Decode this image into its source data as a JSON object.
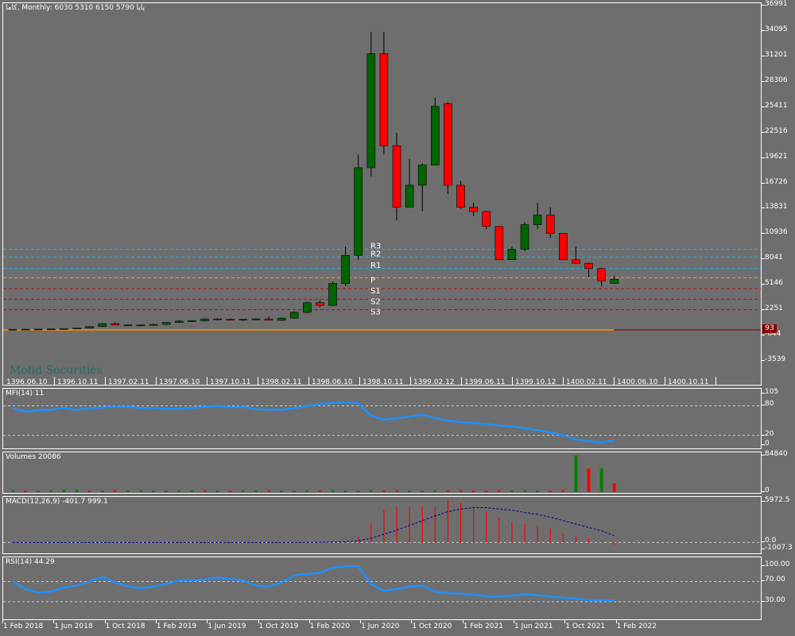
{
  "main_chart": {
    "header": "کاما, Monthly:  6030 5310 6150 5790  پایا",
    "watermark": "Mofid Securities",
    "price_levels": [
      "36991",
      "34095",
      "31201",
      "28306",
      "25411",
      "22516",
      "19621",
      "16726",
      "13831",
      "10936",
      "8041",
      "5146",
      "2251",
      "-644",
      "-3539"
    ],
    "price_values": [
      36991,
      34095,
      31201,
      28306,
      25411,
      22516,
      19621,
      16726,
      13831,
      10936,
      8041,
      5146,
      2251,
      -644,
      -3539
    ],
    "pivot_labels": [
      "R3",
      "R2",
      "R1",
      "P",
      "S1",
      "S2",
      "S3"
    ],
    "last_value_badge": "93",
    "top_date_labels": [
      "1396.06.10",
      "1396.10.11",
      "1397.02.11",
      "1397.06.10",
      "1397.10.11",
      "1398.02.11",
      "1398.06.10",
      "1398.10.11",
      "1399.02.12",
      "1399.06.11",
      "1399.10.12",
      "1400.02.11",
      "1400.06.10",
      "1400.10.11"
    ]
  },
  "chart_data": {
    "type": "candlestick",
    "candles": [
      {
        "o": 60,
        "h": 80,
        "l": 40,
        "c": 70
      },
      {
        "o": 70,
        "h": 90,
        "l": 50,
        "c": 80
      },
      {
        "o": 80,
        "h": 110,
        "l": 60,
        "c": 90
      },
      {
        "o": 90,
        "h": 130,
        "l": 70,
        "c": 110
      },
      {
        "o": 110,
        "h": 160,
        "l": 90,
        "c": 140
      },
      {
        "o": 140,
        "h": 220,
        "l": 120,
        "c": 200
      },
      {
        "o": 200,
        "h": 420,
        "l": 180,
        "c": 380
      },
      {
        "o": 380,
        "h": 800,
        "l": 350,
        "c": 720
      },
      {
        "o": 720,
        "h": 850,
        "l": 520,
        "c": 560
      },
      {
        "o": 560,
        "h": 650,
        "l": 420,
        "c": 520
      },
      {
        "o": 520,
        "h": 620,
        "l": 430,
        "c": 560
      },
      {
        "o": 560,
        "h": 700,
        "l": 480,
        "c": 620
      },
      {
        "o": 620,
        "h": 900,
        "l": 580,
        "c": 850
      },
      {
        "o": 850,
        "h": 1100,
        "l": 800,
        "c": 1000
      },
      {
        "o": 1000,
        "h": 1150,
        "l": 900,
        "c": 1050
      },
      {
        "o": 1050,
        "h": 1300,
        "l": 950,
        "c": 1250
      },
      {
        "o": 1250,
        "h": 1350,
        "l": 1100,
        "c": 1200
      },
      {
        "o": 1200,
        "h": 1300,
        "l": 1050,
        "c": 1150
      },
      {
        "o": 1150,
        "h": 1250,
        "l": 1000,
        "c": 1200
      },
      {
        "o": 1200,
        "h": 1350,
        "l": 1100,
        "c": 1250
      },
      {
        "o": 1250,
        "h": 1500,
        "l": 1150,
        "c": 1100
      },
      {
        "o": 1100,
        "h": 1400,
        "l": 1000,
        "c": 1350
      },
      {
        "o": 1350,
        "h": 2100,
        "l": 1300,
        "c": 2000
      },
      {
        "o": 2000,
        "h": 3200,
        "l": 1900,
        "c": 3100
      },
      {
        "o": 3100,
        "h": 3400,
        "l": 2600,
        "c": 2800
      },
      {
        "o": 2800,
        "h": 5500,
        "l": 2700,
        "c": 5300
      },
      {
        "o": 5300,
        "h": 9500,
        "l": 5000,
        "c": 8500
      },
      {
        "o": 8500,
        "h": 20000,
        "l": 8000,
        "c": 18500
      },
      {
        "o": 18500,
        "h": 34000,
        "l": 17500,
        "c": 31500
      },
      {
        "o": 31500,
        "h": 34000,
        "l": 20000,
        "c": 21000
      },
      {
        "o": 21000,
        "h": 22500,
        "l": 12500,
        "c": 14000
      },
      {
        "o": 14000,
        "h": 19500,
        "l": 14000,
        "c": 16500
      },
      {
        "o": 16500,
        "h": 19000,
        "l": 13500,
        "c": 18800
      },
      {
        "o": 18800,
        "h": 26500,
        "l": 20000,
        "c": 25500
      },
      {
        "o": 25800,
        "h": 26000,
        "l": 15500,
        "c": 16500
      },
      {
        "o": 16500,
        "h": 17000,
        "l": 13800,
        "c": 14000
      },
      {
        "o": 14000,
        "h": 14500,
        "l": 13000,
        "c": 13500
      },
      {
        "o": 13500,
        "h": 13600,
        "l": 11500,
        "c": 11800
      },
      {
        "o": 11800,
        "h": 11800,
        "l": 8000,
        "c": 8000
      },
      {
        "o": 8000,
        "h": 9500,
        "l": 8000,
        "c": 9200
      },
      {
        "o": 9200,
        "h": 12300,
        "l": 9000,
        "c": 12000
      },
      {
        "o": 12000,
        "h": 14500,
        "l": 11500,
        "c": 13100
      },
      {
        "o": 13100,
        "h": 14000,
        "l": 10500,
        "c": 11000
      },
      {
        "o": 11000,
        "h": 11000,
        "l": 8000,
        "c": 8000
      },
      {
        "o": 8000,
        "h": 9500,
        "l": 7500,
        "c": 7600
      },
      {
        "o": 7600,
        "h": 7700,
        "l": 6000,
        "c": 7000
      },
      {
        "o": 7000,
        "h": 7100,
        "l": 5000,
        "c": 5600
      },
      {
        "o": 5310,
        "h": 6150,
        "l": 5310,
        "c": 5790
      }
    ],
    "pivot_values": [
      9200,
      8300,
      7000,
      5950,
      4700,
      3500,
      2300
    ]
  },
  "mfi": {
    "title": "MFI(14) 11",
    "levels": [
      "105",
      "80",
      "20",
      "0"
    ],
    "level_values": [
      105,
      80,
      20,
      0
    ],
    "values": [
      75,
      68,
      71,
      72,
      76,
      72,
      75,
      77,
      78,
      78,
      76,
      75,
      74,
      74,
      76,
      78,
      80,
      77,
      78,
      73,
      72,
      72,
      75,
      80,
      84,
      86,
      87,
      85,
      60,
      52,
      55,
      58,
      62,
      55,
      50,
      47,
      45,
      43,
      40,
      38,
      35,
      30,
      26,
      20,
      12,
      8,
      6,
      10
    ]
  },
  "volumes": {
    "title": "Volumes 20086",
    "levels": [
      "84840",
      "0"
    ],
    "level_values": [
      84840,
      0
    ],
    "values": [
      1500,
      1200,
      1800,
      2200,
      5500,
      6000,
      3000,
      1000,
      900,
      800,
      700,
      600,
      1000,
      1100,
      1200,
      800,
      900,
      700,
      600,
      800,
      1000,
      1500,
      1800,
      1200,
      1400,
      1300,
      1000,
      1200,
      2500,
      1800,
      1600,
      1500,
      2000,
      2500,
      1800,
      1600,
      1400,
      1200,
      1100,
      1300,
      1200,
      1000,
      900,
      2000,
      84840,
      55000,
      55000,
      20086
    ],
    "up": [
      1,
      0,
      1,
      1,
      1,
      1,
      0,
      1,
      0,
      1,
      1,
      1,
      1,
      1,
      1,
      0,
      1,
      0,
      1,
      1,
      0,
      1,
      1,
      1,
      0,
      1,
      1,
      1,
      1,
      0,
      0,
      1,
      1,
      1,
      0,
      0,
      0,
      0,
      0,
      1,
      1,
      1,
      0,
      0,
      1,
      0,
      1,
      0
    ]
  },
  "macd": {
    "title": "MACD(12,26,9) -401.7 999.1",
    "levels": [
      "5972.5",
      "0.0",
      "-1007.3"
    ],
    "level_values": [
      5972.5,
      0,
      -1007.3
    ],
    "histogram": [
      0,
      0,
      0,
      0,
      0,
      0,
      0,
      0,
      0,
      0,
      0,
      0,
      0,
      0,
      0,
      0,
      0,
      0,
      0,
      0,
      0,
      0,
      0,
      10,
      50,
      80,
      200,
      800,
      2800,
      4800,
      5200,
      5200,
      5200,
      5200,
      6200,
      5800,
      5100,
      4500,
      3600,
      3000,
      2700,
      2400,
      2000,
      1400,
      900,
      600,
      300,
      -401.7
    ],
    "signal": [
      0,
      0,
      0,
      0,
      0,
      0,
      0,
      0,
      0,
      0,
      0,
      0,
      0,
      0,
      0,
      0,
      0,
      0,
      0,
      0,
      0,
      0,
      0,
      5,
      20,
      50,
      100,
      250,
      600,
      1200,
      1800,
      2500,
      3200,
      3900,
      4500,
      4900,
      5100,
      5100,
      4900,
      4700,
      4400,
      4100,
      3700,
      3200,
      2700,
      2200,
      1700,
      999.1
    ]
  },
  "rsi": {
    "title": "RSI(14) 44.29",
    "levels": [
      "100.00",
      "70.00",
      "30.00"
    ],
    "level_values": [
      100,
      70,
      30
    ],
    "values": [
      70,
      55,
      48,
      50,
      58,
      62,
      70,
      79,
      68,
      60,
      57,
      60,
      65,
      72,
      72,
      74,
      78,
      75,
      72,
      62,
      60,
      68,
      82,
      85,
      87,
      97,
      100,
      100,
      65,
      52,
      55,
      60,
      62,
      50,
      47,
      46,
      44,
      41,
      40,
      42,
      45,
      43,
      40,
      38,
      36,
      34,
      33,
      33
    ]
  },
  "bottom_date_labels": [
    "1 Feb 2018",
    "1 Jun 2018",
    "1 Oct 2018",
    "1 Feb 2019",
    "1 Jun 2019",
    "1 Oct 2019",
    "1 Feb 2020",
    "1 Jun 2020",
    "1 Oct 2020",
    "1 Feb 2021",
    "1 Jun 2021",
    "1 Oct 2021",
    "1 Feb 2022"
  ],
  "colors": {
    "background": "#6e6e6e",
    "bull": "#006400",
    "bear": "#ff0000",
    "wick": "#000000",
    "indicator_line": "#1e90ff",
    "macd_signal": "#00008b",
    "pivot_upper": "#00bfff",
    "pivot_mid": "#ffa500",
    "pivot_lower": "#cc0000",
    "zero_line": "#ff8c00",
    "badge": "#8b0000"
  }
}
